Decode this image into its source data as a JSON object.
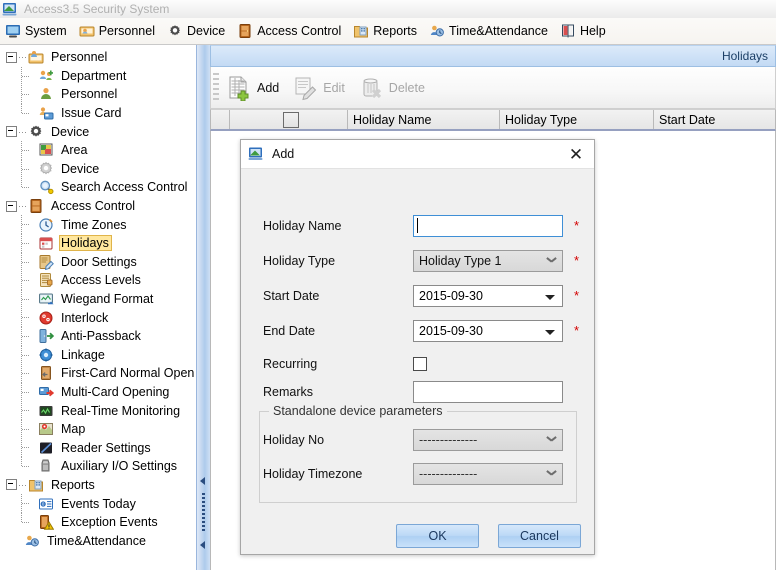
{
  "window": {
    "title": "Access3.5 Security System",
    "icon": "app-icon"
  },
  "menu": {
    "items": [
      {
        "label": "System",
        "icon": "monitor-icon"
      },
      {
        "label": "Personnel",
        "icon": "personnel-card-icon"
      },
      {
        "label": "Device",
        "icon": "gear-icon"
      },
      {
        "label": "Access Control",
        "icon": "door-icon"
      },
      {
        "label": "Reports",
        "icon": "reports-folder-icon"
      },
      {
        "label": "Time&Attendance",
        "icon": "people-clock-icon"
      },
      {
        "label": "Help",
        "icon": "book-icon"
      }
    ]
  },
  "sidebar": {
    "nodes": [
      {
        "label": "Personnel",
        "level": 1,
        "expander": "minus",
        "icon": "personnel-group-icon",
        "selected": false
      },
      {
        "label": "Department",
        "level": 2,
        "icon": "department-icon",
        "selected": false
      },
      {
        "label": "Personnel",
        "level": 2,
        "icon": "person-icon",
        "selected": false
      },
      {
        "label": "Issue Card",
        "level": 2,
        "icon": "issue-card-icon",
        "selected": false
      },
      {
        "label": "Device",
        "level": 1,
        "expander": "minus",
        "icon": "gear-icon",
        "selected": false
      },
      {
        "label": "Area",
        "level": 2,
        "icon": "area-icon",
        "selected": false
      },
      {
        "label": "Device",
        "level": 2,
        "icon": "gear-gray-icon",
        "selected": false
      },
      {
        "label": "Search Access Control",
        "level": 2,
        "icon": "magnifier-icon",
        "selected": false
      },
      {
        "label": "Access Control",
        "level": 1,
        "expander": "minus",
        "icon": "door-icon",
        "selected": false
      },
      {
        "label": "Time Zones",
        "level": 2,
        "icon": "clock-icon",
        "selected": false
      },
      {
        "label": "Holidays",
        "level": 2,
        "icon": "calendar-icon",
        "selected": true
      },
      {
        "label": "Door Settings",
        "level": 2,
        "icon": "door-settings-icon",
        "selected": false
      },
      {
        "label": "Access Levels",
        "level": 2,
        "icon": "access-levels-icon",
        "selected": false
      },
      {
        "label": "Wiegand Format",
        "level": 2,
        "icon": "wiegand-icon",
        "selected": false
      },
      {
        "label": "Interlock",
        "level": 2,
        "icon": "interlock-icon",
        "selected": false
      },
      {
        "label": "Anti-Passback",
        "level": 2,
        "icon": "anti-passback-icon",
        "selected": false
      },
      {
        "label": "Linkage",
        "level": 2,
        "icon": "linkage-icon",
        "selected": false
      },
      {
        "label": "First-Card Normal Open",
        "level": 2,
        "icon": "first-card-icon",
        "selected": false
      },
      {
        "label": "Multi-Card Opening",
        "level": 2,
        "icon": "multi-card-icon",
        "selected": false
      },
      {
        "label": "Real-Time Monitoring",
        "level": 2,
        "icon": "monitoring-icon",
        "selected": false
      },
      {
        "label": "Map",
        "level": 2,
        "icon": "map-icon",
        "selected": false
      },
      {
        "label": "Reader Settings",
        "level": 2,
        "icon": "reader-icon",
        "selected": false
      },
      {
        "label": "Auxiliary I/O Settings",
        "level": 2,
        "icon": "auxiliary-icon",
        "selected": false
      },
      {
        "label": "Reports",
        "level": 1,
        "expander": "minus",
        "icon": "reports-folder-icon",
        "selected": false
      },
      {
        "label": "Events Today",
        "level": 2,
        "icon": "events-today-icon",
        "selected": false
      },
      {
        "label": "Exception Events",
        "level": 2,
        "icon": "exception-events-icon",
        "selected": false
      },
      {
        "label": "Time&Attendance",
        "level": 1,
        "icon": "people-clock-icon",
        "selected": false
      }
    ]
  },
  "main": {
    "panel_title": "Holidays",
    "toolbar": [
      {
        "label": "Add",
        "icon": "add-record-icon",
        "disabled": false
      },
      {
        "label": "Edit",
        "icon": "edit-pencil-icon",
        "disabled": true
      },
      {
        "label": "Delete",
        "icon": "delete-trash-icon",
        "disabled": true
      }
    ],
    "table": {
      "columns": [
        "",
        "",
        "Holiday Name",
        "Holiday Type",
        "Start Date"
      ],
      "rows": []
    }
  },
  "dialog": {
    "title": "Add",
    "icon": "app-icon",
    "close_label": "✕",
    "fields": {
      "holiday_name": {
        "label": "Holiday Name",
        "value": "",
        "required": "*"
      },
      "holiday_type": {
        "label": "Holiday Type",
        "value": "Holiday Type 1",
        "required": "*"
      },
      "start_date": {
        "label": "Start Date",
        "value": "2015-09-30",
        "required": "*"
      },
      "end_date": {
        "label": "End Date",
        "value": "2015-09-30",
        "required": "*"
      },
      "recurring": {
        "label": "Recurring",
        "checked": false
      },
      "remarks": {
        "label": "Remarks",
        "value": ""
      }
    },
    "group": {
      "title": "Standalone device parameters",
      "holiday_no": {
        "label": "Holiday No",
        "value": "--------------"
      },
      "holiday_timezone": {
        "label": "Holiday Timezone",
        "value": "--------------"
      }
    },
    "buttons": {
      "ok": "OK",
      "cancel": "Cancel"
    }
  },
  "colors": {
    "accent": "#c3daf4",
    "selection": "#ffe79e",
    "required": "#d40000",
    "focus_border": "#3f8fd6"
  }
}
